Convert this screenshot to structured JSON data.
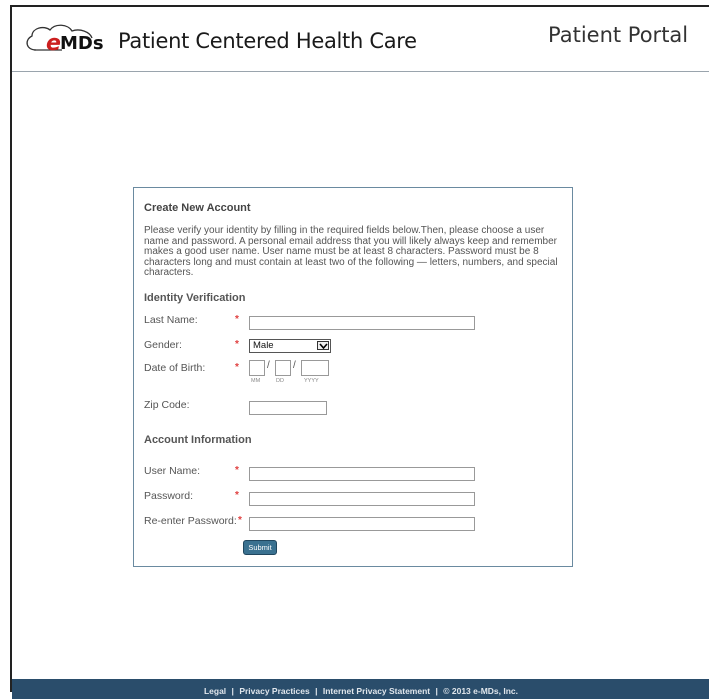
{
  "header": {
    "brand": "e-MDs",
    "tagline": "Patient Centered Health Care",
    "portal_title": "Patient Portal",
    "brand_color": "#1a1a1a",
    "accent_color": "#2a4d6b"
  },
  "form": {
    "title": "Create New Account",
    "intro": "Please verify your identity by filling in the required fields below.Then, please choose a user name and password. A personal email address that you will likely always keep and remember makes a good user name. User name must be at least 8 characters. Password must be 8 characters long and must contain at least two of the following — letters, numbers, and special characters.",
    "identity_section": "Identity Verification",
    "account_section": "Account Information",
    "required_mark": "*",
    "fields": {
      "last_name": {
        "label": "Last Name:",
        "value": ""
      },
      "gender": {
        "label": "Gender:",
        "value": "Male"
      },
      "dob": {
        "label": "Date of Birth:",
        "mm_hint": "MM",
        "dd_hint": "DD",
        "yyyy_hint": "YYYY",
        "separator": "/"
      },
      "zip": {
        "label": "Zip Code:",
        "value": ""
      },
      "username": {
        "label": "User Name:",
        "value": ""
      },
      "password": {
        "label": "Password:",
        "value": ""
      },
      "password_confirm": {
        "label": "Re-enter Password:",
        "value": ""
      }
    },
    "submit_label": "Submit",
    "required_color": "#e04040",
    "button_color": "#3a7190"
  },
  "footer": {
    "links": [
      "Legal",
      "Privacy Practices",
      "Internet Privacy Statement"
    ],
    "separator": "|",
    "copyright": "© 2013 e-MDs, Inc."
  }
}
